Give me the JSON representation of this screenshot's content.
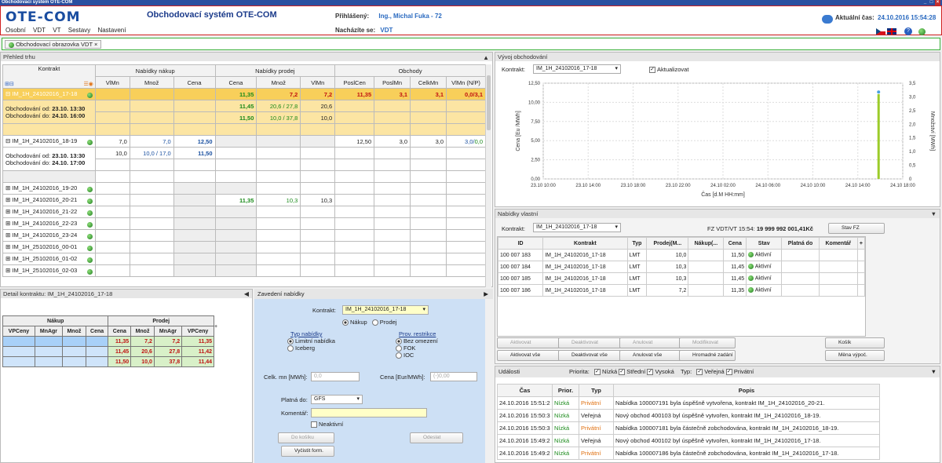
{
  "window": {
    "title": "Obchodovací systém OTE-COM"
  },
  "header": {
    "logo": "OTE-COM",
    "app_title": "Obchodovací systém OTE-COM",
    "logged_label": "Přihlášený:",
    "logged_user": "Ing., Michal Fuka - 72",
    "location_label": "Nacházíte se:",
    "location_value": "VDT",
    "time_label": "Aktuální čas:",
    "time_value": "24.10.2016 15:54:28",
    "menu": [
      "Osobní",
      "VDT",
      "VT",
      "Sestavy",
      "Nastavení"
    ]
  },
  "tab": {
    "label": "Obchodovací obrazovka VDT"
  },
  "market": {
    "title": "Přehled trhu",
    "group_headers": {
      "contract": "Kontrakt",
      "buy": "Nabídky nákup",
      "sell": "Nabídky prodej",
      "trades": "Obchody"
    },
    "col_headers": [
      "VlMn",
      "Množ",
      "Cena",
      "Cena",
      "Množ",
      "VlMn",
      "PoslCen",
      "PoslMn",
      "CelkMn",
      "VlMn (N/P)"
    ],
    "contracts": [
      {
        "name": "IM_1H_24102016_17-18",
        "from_label": "Obchodování od:",
        "from": "23.10. 13:30",
        "to_label": "Obchodování do:",
        "to": "24.10. 16:00",
        "rows": [
          {
            "sc": "11,35",
            "sq": "7,2",
            "sv": "7,2",
            "pc": "11,35",
            "pm": "3,1",
            "cm": "3,1",
            "vm1": "0,0",
            "vm2": "3,1"
          },
          {
            "sc": "11,45",
            "sq": "20,6 / 27,8",
            "sv": "20,6"
          },
          {
            "sc": "11,50",
            "sq": "10,0 / 37,8",
            "sv": "10,0"
          },
          {}
        ]
      },
      {
        "name": "IM_1H_24102016_18-19",
        "from_label": "Obchodování od:",
        "from": "23.10. 13:30",
        "to_label": "Obchodování do:",
        "to": "24.10. 17:00",
        "rows": [
          {
            "bv": "7,0",
            "bq": "7,0",
            "bc": "12,50",
            "pc": "12,50",
            "pm": "3,0",
            "cm": "3,0",
            "vm1": "3,0",
            "vm2": "0,0"
          },
          {
            "bv": "10,0",
            "bq": "10,0 / 17,0",
            "bc": "11,50"
          },
          {},
          {}
        ]
      }
    ],
    "collapsed": [
      {
        "name": "IM_1H_24102016_19-20"
      },
      {
        "name": "IM_1H_24102016_20-21",
        "sc": "11,35",
        "sq": "10,3",
        "sv": "10,3"
      },
      {
        "name": "IM_1H_24102016_21-22"
      },
      {
        "name": "IM_1H_24102016_22-23"
      },
      {
        "name": "IM_1H_24102016_23-24"
      },
      {
        "name": "IM_1H_25102016_00-01"
      },
      {
        "name": "IM_1H_25102016_01-02"
      },
      {
        "name": "IM_1H_25102016_02-03"
      }
    ]
  },
  "detail": {
    "title": "Detail kontraktu: IM_1H_24102016_17-18",
    "buy_label": "Nákup",
    "sell_label": "Prodej",
    "cols": [
      "VPCeny",
      "MnAgr",
      "Množ",
      "Cena",
      "Cena",
      "Množ",
      "MnAgr",
      "VPCeny"
    ],
    "rows": [
      [
        "",
        "",
        "",
        "",
        "11,35",
        "7,2",
        "7,2",
        "11,35"
      ],
      [
        "",
        "",
        "",
        "",
        "11,45",
        "20,6",
        "27,8",
        "11,42"
      ],
      [
        "",
        "",
        "",
        "",
        "11,50",
        "10,0",
        "37,8",
        "11,44"
      ]
    ]
  },
  "order_form": {
    "title": "Zavedení nabídky",
    "contract_label": "Kontrakt:",
    "contract_value": "IM_1H_24102016_17-18",
    "buy": "Nákup",
    "sell": "Prodej",
    "type_label": "Typ nabídky",
    "type_options": [
      "Limitní nabídka",
      "Iceberg"
    ],
    "restr_label": "Prov. restrikce",
    "restr_options": [
      "Bez omezení",
      "FOK",
      "IOC"
    ],
    "qty_label": "Celk. mn [MWh]:",
    "qty_placeholder": "0,0",
    "price_label": "Cena [Eur/MWh]:",
    "price_placeholder": "(-)0,00",
    "valid_label": "Platná do:",
    "valid_value": "GFS",
    "comment_label": "Komentář:",
    "inactive_label": "Neaktivní",
    "basket_btn": "Do košíku",
    "send_btn": "Odeslat",
    "clear_btn": "Vyčistit form."
  },
  "chart_panel": {
    "title": "Vývoj obchodování",
    "contract_label": "Kontrakt:",
    "contract_value": "IM_1H_24102016_17-18",
    "refresh_label": "Aktualizovat"
  },
  "chart_data": {
    "type": "bar",
    "ylabel": "Cena [Eu /MWh]",
    "y2label": "Množství [MWh]",
    "xlabel": "Čas [d.M HH:mm]",
    "ylim": [
      0,
      12.5
    ],
    "y2lim": [
      0,
      3.5
    ],
    "yticks": [
      "0,00",
      "2,50",
      "5,00",
      "7,50",
      "10,00",
      "12,50"
    ],
    "y2ticks": [
      "0",
      "0,5",
      "1,0",
      "1,5",
      "2,0",
      "2,5",
      "3,0",
      "3,5"
    ],
    "xticks": [
      "23.10 10:00",
      "23.10 14:00",
      "23.10 18:00",
      "23.10 22:00",
      "24.10 02:00",
      "24.10 06:00",
      "24.10 10:00",
      "24.10 14:00",
      "24.10 18:00"
    ],
    "series": [
      {
        "type": "bar",
        "x": "24.10 15:51",
        "values": [
          3.1
        ],
        "color": "#9ccc2a"
      },
      {
        "type": "point",
        "x": "24.10 15:51",
        "values": [
          11.35
        ],
        "color": "#4aa0e0"
      }
    ]
  },
  "own_offers": {
    "title": "Nabídky vlastní",
    "contract_label": "Kontrakt:",
    "contract_value": "IM_1H_24102016_17-18",
    "fz_label": "FZ VDT/VT 15:54:",
    "fz_value": "19 999 992 001,41Kč",
    "fz_btn": "Stav FZ",
    "cols": [
      "ID",
      "Kontrakt",
      "Typ",
      "Prodej(M...",
      "Nákup(...",
      "Cena",
      "Stav",
      "Platná do",
      "Komentář"
    ],
    "rows": [
      [
        "100 007 183",
        "IM_1H_24102016_17-18",
        "LMT",
        "10,0",
        "",
        "11,50",
        "Aktivní",
        "",
        ""
      ],
      [
        "100 007 184",
        "IM_1H_24102016_17-18",
        "LMT",
        "10,3",
        "",
        "11,45",
        "Aktivní",
        "",
        ""
      ],
      [
        "100 007 185",
        "IM_1H_24102016_17-18",
        "LMT",
        "10,3",
        "",
        "11,45",
        "Aktivní",
        "",
        ""
      ],
      [
        "100 007 186",
        "IM_1H_24102016_17-18",
        "LMT",
        "7,2",
        "",
        "11,35",
        "Aktivní",
        "",
        ""
      ]
    ],
    "buttons": {
      "activate": "Aktivovat",
      "deactivate": "Deaktivovat",
      "cancel": "Anulovat",
      "modify": "Modifikovat",
      "basket": "Košík",
      "activate_all": "Aktivovat vše",
      "deactivate_all": "Deaktivovat vše",
      "cancel_all": "Anulovat vše",
      "mass": "Hromadné zadání",
      "currency": "Měna výpoč."
    }
  },
  "events": {
    "title": "Události",
    "prio_label": "Priorita:",
    "prio_opts": [
      "Nízká",
      "Střední",
      "Vysoká"
    ],
    "type_label": "Typ:",
    "type_opts": [
      "Veřejná",
      "Privátní"
    ],
    "cols": [
      "Čas",
      "Prior.",
      "Typ",
      "Popis"
    ],
    "rows": [
      [
        "24.10.2016 15:51:2",
        "Nízká",
        "Privátní",
        "Nabídka 100007191 byla úspěšně vytvořena, kontrakt IM_1H_24102016_20-21."
      ],
      [
        "24.10.2016 15:50:3",
        "Nízká",
        "Veřejná",
        "Nový obchod 400103 byl úspěšně vytvořen, kontrakt IM_1H_24102016_18-19."
      ],
      [
        "24.10.2016 15:50:3",
        "Nízká",
        "Privátní",
        "Nabídka 100007181 byla částečně zobchodována, kontrakt IM_1H_24102016_18-19."
      ],
      [
        "24.10.2016 15:49:2",
        "Nízká",
        "Veřejná",
        "Nový obchod 400102 byl úspěšně vytvořen, kontrakt IM_1H_24102016_17-18."
      ],
      [
        "24.10.2016 15:49:2",
        "Nízká",
        "Privátní",
        "Nabídka 100007186 byla částečně zobchodována, kontrakt IM_1H_24102016_17-18."
      ]
    ]
  }
}
